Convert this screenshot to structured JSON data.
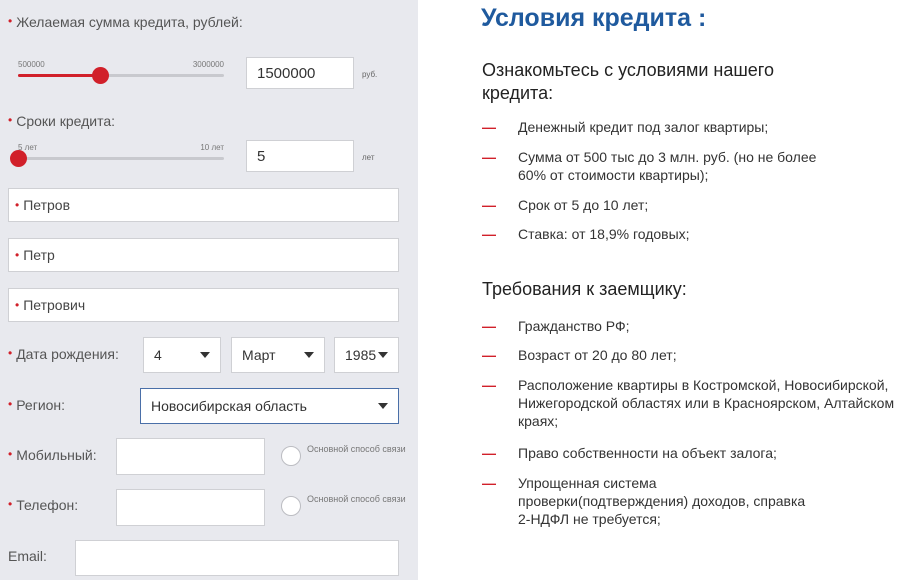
{
  "form": {
    "amount": {
      "label": "Желаемая сумма кредита, рублей",
      "min_label": "500000",
      "max_label": "3000000",
      "value": "1500000",
      "unit": "руб.",
      "position": 0.4
    },
    "term": {
      "label": "Сроки кредита",
      "min_label": "5 лет",
      "max_label": "10 лет",
      "value": "5",
      "unit": "лет",
      "position": 0.0
    },
    "last_name": "Петров",
    "first_name": "Петр",
    "middle_name": "Петрович",
    "birth_date": {
      "label": "Дата рождения",
      "day": "4",
      "month": "Март",
      "year": "1985"
    },
    "region": {
      "label": "Регион",
      "value": "Новосибирская область"
    },
    "mobile": {
      "label": "Мобильный",
      "value": "",
      "radio_label": "Основной способ связи"
    },
    "phone": {
      "label": "Телефон",
      "value": "",
      "radio_label": "Основной способ связи"
    },
    "email": {
      "label": "Email",
      "value": ""
    }
  },
  "info": {
    "title": "Условия кредита :",
    "section1": {
      "heading": "Ознакомьтесь с условиями нашего кредита:",
      "items": [
        "Денежный кредит под залог квартиры;",
        "Сумма от 500 тыс до 3 млн. руб. (но не более 60% от стоимости квартиры);",
        "Срок от 5 до 10 лет;",
        "Ставка: от 18,9% годовых;"
      ]
    },
    "section2": {
      "heading": "Требования к заемщику:",
      "items": [
        "Гражданство РФ;",
        "Возраст от 20 до 80 лет;",
        "Расположение квартиры в Костромской, Новосибирской, Нижегородской областях или в Красноярском, Алтайском краях;",
        "Право собственности на объект залога;",
        "Упрощенная система проверки(подтверждения) доходов, справка 2-НДФЛ не требуется;"
      ]
    },
    "dash": "—"
  },
  "colors": {
    "accent": "#d1202a",
    "title": "#1f5a9e",
    "panel_bg": "#e8e9ee"
  }
}
